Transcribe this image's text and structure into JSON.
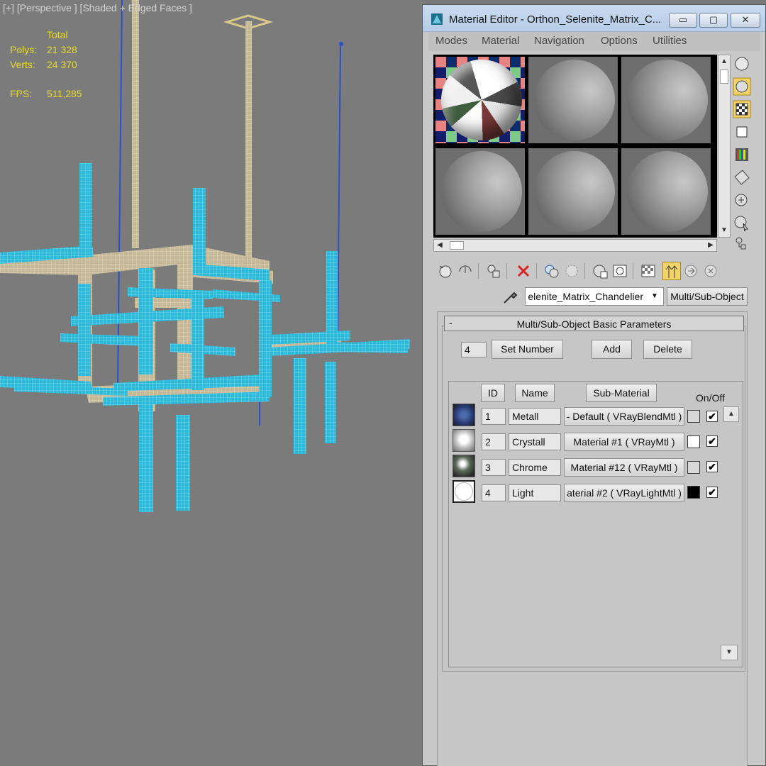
{
  "viewport": {
    "label": "[+] [Perspective ] [Shaded + Edged Faces ]",
    "stats": {
      "total_label": "Total",
      "polys_label": "Polys:",
      "polys_value": "21 328",
      "verts_label": "Verts:",
      "verts_value": "24 370",
      "fps_label": "FPS:",
      "fps_value": "511,285"
    }
  },
  "material_editor": {
    "title": "Material Editor - Orthon_Selenite_Matrix_C...",
    "window_buttons": {
      "minimize": "▭",
      "maximize": "▢",
      "close": "✕"
    },
    "menu": [
      "Modes",
      "Material",
      "Navigation",
      "Options",
      "Utilities"
    ],
    "material_name": "elenite_Matrix_Chandelier",
    "material_type": "Multi/Sub-Object",
    "rollout": {
      "collapse": "-",
      "title": "Multi/Sub-Object Basic Parameters",
      "count": "4",
      "set_number": "Set Number",
      "add": "Add",
      "delete": "Delete",
      "col_id": "ID",
      "col_name": "Name",
      "col_submaterial": "Sub-Material",
      "col_onoff": "On/Off",
      "rows": [
        {
          "id": "1",
          "name": "Metall",
          "submaterial": "- Default  ( VRayBlendMtl )",
          "swatch_color": "#d8d8d8",
          "enabled": "✔"
        },
        {
          "id": "2",
          "name": "Crystall",
          "submaterial": "Material #1  ( VRayMtl )",
          "swatch_color": "#ffffff",
          "enabled": "✔"
        },
        {
          "id": "3",
          "name": "Chrome",
          "submaterial": "Material #12  ( VRayMtl )",
          "swatch_color": "#d8d8d8",
          "enabled": "✔"
        },
        {
          "id": "4",
          "name": "Light",
          "submaterial": "aterial #2  ( VRayLightMtl )",
          "swatch_color": "#000000",
          "enabled": "✔"
        }
      ]
    }
  },
  "colors": {
    "viewport_bg": "#7b7b7b",
    "stats_text": "#e6dc2a",
    "wire_cyan": "#3ec8e8",
    "wire_tan": "#c9bb96",
    "wire_blue": "#2a50c8"
  }
}
